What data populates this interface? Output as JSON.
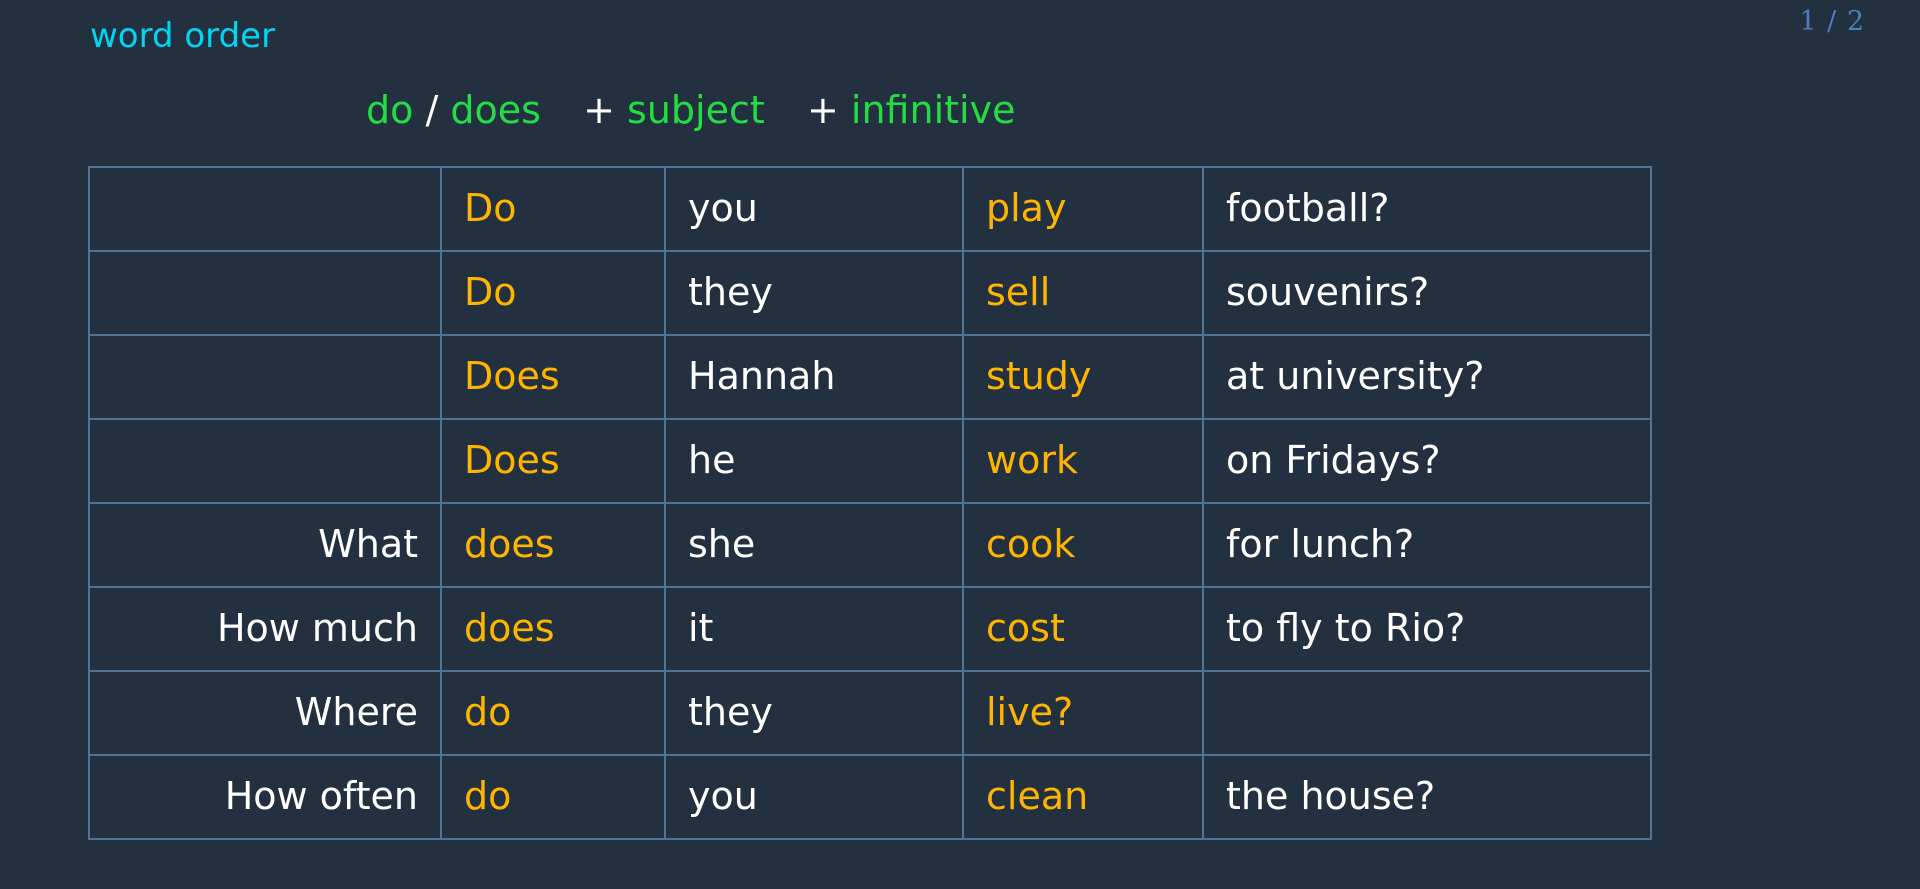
{
  "page": {
    "indicator": "1 / 2",
    "background_color": "#22303f",
    "border_color": "#4f7296"
  },
  "title": {
    "text": "word order",
    "color": "#00d5f2"
  },
  "pattern": {
    "parts": [
      {
        "text": "do",
        "kind": "keyword",
        "color": "#22dd44"
      },
      {
        "text": "/",
        "kind": "operator",
        "color": "#ffffff"
      },
      {
        "text": "does",
        "kind": "keyword",
        "color": "#22dd44"
      },
      {
        "text": "+",
        "kind": "operator",
        "color": "#ffffff"
      },
      {
        "text": "subject",
        "kind": "keyword",
        "color": "#22dd44"
      },
      {
        "text": "+",
        "kind": "operator",
        "color": "#ffffff"
      },
      {
        "text": "infinitive",
        "kind": "keyword",
        "color": "#22dd44"
      }
    ],
    "flat": "do / does  + subject  + infinitive"
  },
  "table": {
    "column_colors": [
      "#ffffff",
      "#ffb400",
      "#ffffff",
      "#ffb400",
      "#ffffff"
    ],
    "rows": [
      {
        "question_word": "",
        "auxiliary": "Do",
        "subject": "you",
        "verb": "play",
        "rest": "football?"
      },
      {
        "question_word": "",
        "auxiliary": "Do",
        "subject": "they",
        "verb": "sell",
        "rest": "souvenirs?"
      },
      {
        "question_word": "",
        "auxiliary": "Does",
        "subject": "Hannah",
        "verb": "study",
        "rest": "at university?"
      },
      {
        "question_word": "",
        "auxiliary": "Does",
        "subject": "he",
        "verb": "work",
        "rest": "on Fridays?"
      },
      {
        "question_word": "What",
        "auxiliary": "does",
        "subject": "she",
        "verb": "cook",
        "rest": "for lunch?"
      },
      {
        "question_word": "How much",
        "auxiliary": "does",
        "subject": "it",
        "verb": "cost",
        "rest": "to fly to Rio?"
      },
      {
        "question_word": "Where",
        "auxiliary": "do",
        "subject": "they",
        "verb": "live?",
        "rest": ""
      },
      {
        "question_word": "How often",
        "auxiliary": "do",
        "subject": "you",
        "verb": "clean",
        "rest": "the house?"
      }
    ]
  }
}
